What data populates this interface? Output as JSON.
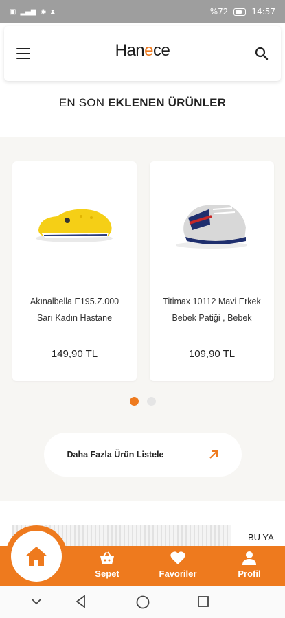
{
  "status_bar": {
    "left_icons": [
      "volte-icon",
      "signal-icon",
      "whatsapp-icon",
      "hourglass-icon"
    ],
    "battery": "%72",
    "time": "14:57"
  },
  "header": {
    "logo_pre": "Han",
    "logo_accent": "e",
    "logo_post": "ce"
  },
  "section": {
    "title_normal": "EN SON ",
    "title_bold": "EKLENEN ÜRÜNLER"
  },
  "products": [
    {
      "name_line1": "Akınalbella E195.Z.000",
      "name_line2": "Sarı Kadın Hastane",
      "price": "149,90 TL"
    },
    {
      "name_line1": "Titimax 10112 Mavi Erkek",
      "name_line2": "Bebek Patiği , Bebek",
      "price": "109,90 TL"
    }
  ],
  "carousel": {
    "active_index": 0,
    "count": 2
  },
  "more_button": {
    "label": "Daha Fazla Ürün Listele"
  },
  "banner": {
    "text": "BU YA"
  },
  "bottom_nav": {
    "items": [
      {
        "label": "Sepet",
        "icon": "basket-icon"
      },
      {
        "label": "Favoriler",
        "icon": "heart-icon"
      },
      {
        "label": "Profil",
        "icon": "person-icon"
      }
    ],
    "home_icon": "home-icon"
  },
  "colors": {
    "accent": "#ee7a1e",
    "background_section": "#f7f6f3",
    "status_bar": "#9e9e9e"
  }
}
